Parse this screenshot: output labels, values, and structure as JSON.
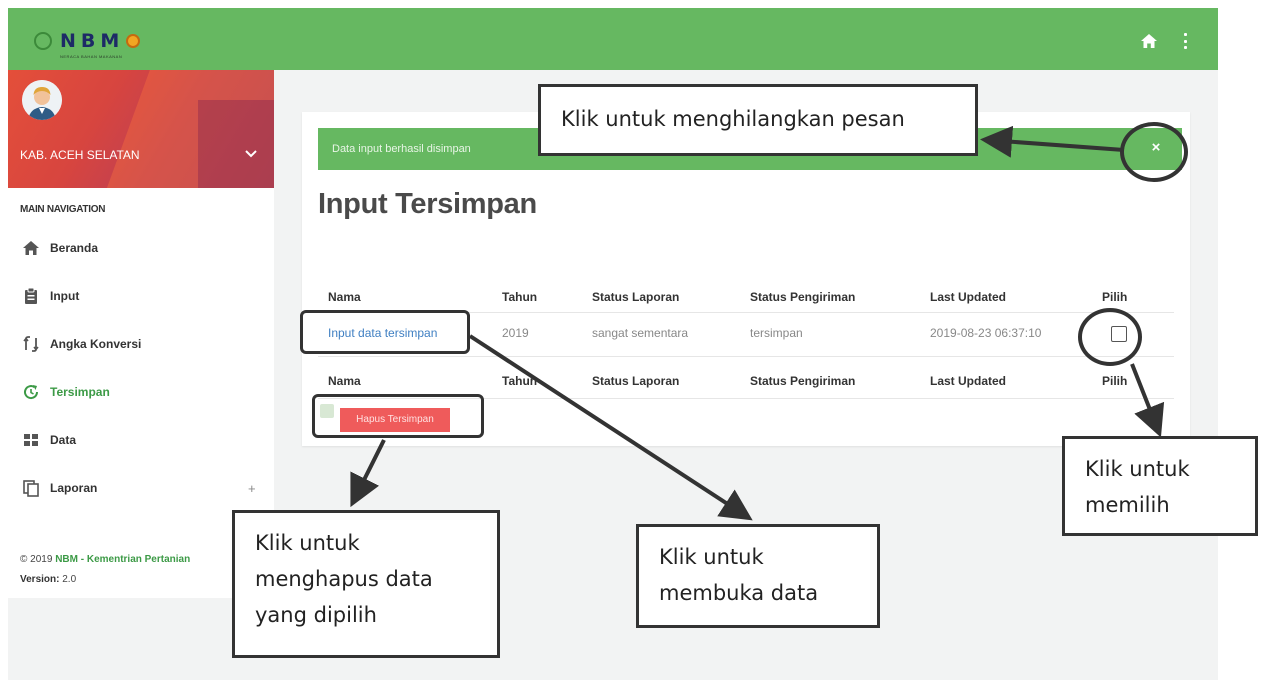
{
  "app": {
    "logo_text": "NBM",
    "logo_subtitle": "NERACA BAHAN MAKANAN"
  },
  "sidebar": {
    "user_location": "KAB. ACEH SELATAN",
    "nav_header": "MAIN NAVIGATION",
    "items": [
      {
        "label": "Beranda",
        "icon": "home-icon"
      },
      {
        "label": "Input",
        "icon": "clipboard-icon"
      },
      {
        "label": "Angka Konversi",
        "icon": "conversion-icon"
      },
      {
        "label": "Tersimpan",
        "icon": "refresh-icon",
        "active": true
      },
      {
        "label": "Data",
        "icon": "dashboard-icon"
      },
      {
        "label": "Laporan",
        "icon": "copy-icon",
        "expand": "+"
      }
    ],
    "footer": {
      "copyright": "© 2019",
      "brand": "NBM - Kementrian Pertanian",
      "version_label": "Version:",
      "version": "2.0"
    }
  },
  "alert": {
    "message": "Data input berhasil disimpan",
    "close": "×"
  },
  "page_title": "Input Tersimpan",
  "table": {
    "headers": [
      "Nama",
      "Tahun",
      "Status Laporan",
      "Status Pengiriman",
      "Last Updated",
      "Pilih"
    ],
    "rows": [
      {
        "nama": "Input data tersimpan",
        "tahun": "2019",
        "status_laporan": "sangat sementara",
        "status_pengiriman": "tersimpan",
        "last_updated": "2019-08-23 06:37:10",
        "pilih": false
      }
    ],
    "delete_button": "Hapus Tersimpan"
  },
  "annotations": {
    "dismiss": "Klik untuk menghilangkan pesan",
    "select": [
      "Klik untuk",
      "memilih"
    ],
    "delete": [
      "Klik untuk",
      "menghapus data",
      "yang dipilih"
    ],
    "open": [
      "Klik untuk",
      "membuka data"
    ]
  },
  "colors": {
    "header_green": "#66b861",
    "active_green": "#3c9a46",
    "link_blue": "#3f7fc2",
    "danger_red": "#ef5b5b"
  }
}
